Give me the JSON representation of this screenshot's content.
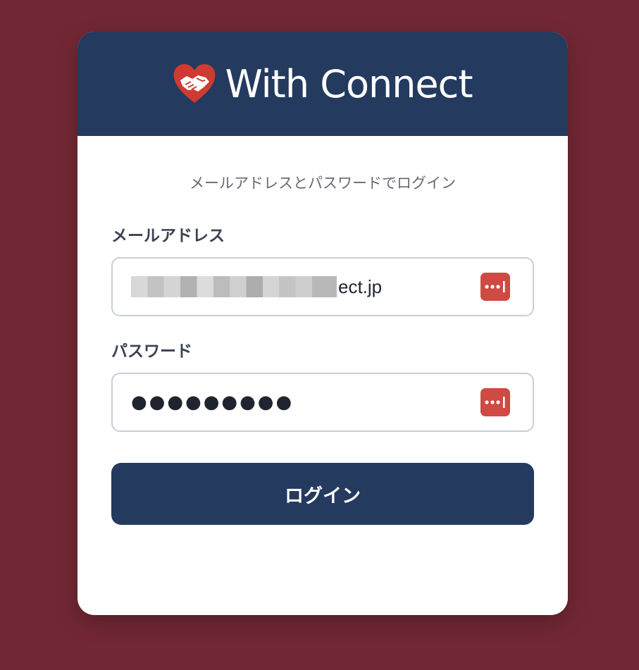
{
  "brand": {
    "name": "With Connect",
    "logo_icon": "heart-handshake-icon",
    "header_color": "#243A5E"
  },
  "form": {
    "subtitle": "メールアドレスとパスワードでログイン",
    "email": {
      "label": "メールアドレス",
      "value_visible_suffix": "ect.jp",
      "value_redacted": true
    },
    "password": {
      "label": "パスワード",
      "value_masked": "●●●●●●●●●"
    },
    "password_manager_icon": "password-manager-icon",
    "submit_label": "ログイン"
  },
  "colors": {
    "background": "#722834",
    "accent": "#CE4A42",
    "button": "#243A5E"
  }
}
